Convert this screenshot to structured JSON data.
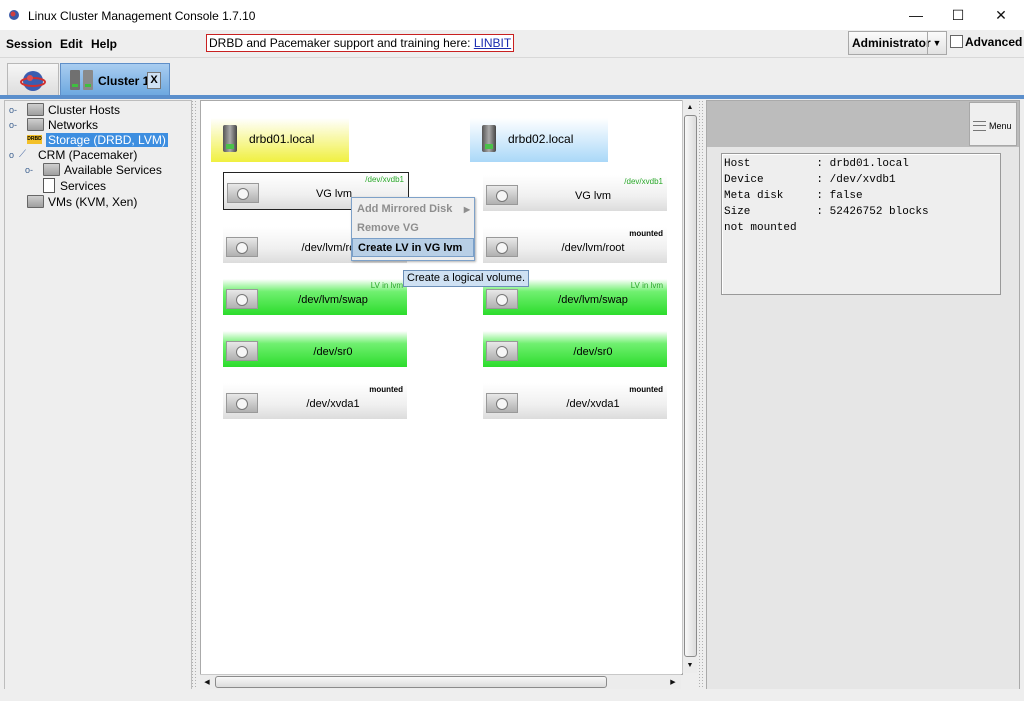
{
  "window": {
    "title": "Linux Cluster Management Console 1.7.10",
    "minimize": "—",
    "maximize": "☐",
    "close": "✕"
  },
  "menubar": {
    "session": "Session",
    "edit": "Edit",
    "help": "Help",
    "banner_text": "DRBD and Pacemaker support and training here: ",
    "banner_link": "LINBIT",
    "user": "Administrator",
    "advanced": "Advanced"
  },
  "tabs": {
    "cluster_label": "Cluster 1",
    "close": "X"
  },
  "tree": {
    "cluster_hosts": "Cluster Hosts",
    "networks": "Networks",
    "storage": "Storage (DRBD, LVM)",
    "crm": "CRM (Pacemaker)",
    "available_services": "Available Services",
    "services": "Services",
    "vms": "VMs (KVM, Xen)"
  },
  "hosts": [
    {
      "name": "drbd01.local"
    },
    {
      "name": "drbd02.local"
    }
  ],
  "blocks_left": [
    {
      "name": "VG lvm",
      "note": "/dev/xvdb1"
    },
    {
      "name": "/dev/lvm/root",
      "note": ""
    },
    {
      "name": "/dev/lvm/swap",
      "note": "LV in lvm"
    },
    {
      "name": "/dev/sr0",
      "note": ""
    },
    {
      "name": "/dev/xvda1",
      "note": "mounted"
    }
  ],
  "blocks_right": [
    {
      "name": "VG lvm",
      "note": "/dev/xvdb1"
    },
    {
      "name": "/dev/lvm/root",
      "note": "mounted"
    },
    {
      "name": "/dev/lvm/swap",
      "note": "LV in lvm"
    },
    {
      "name": "/dev/sr0",
      "note": ""
    },
    {
      "name": "/dev/xvda1",
      "note": "mounted"
    }
  ],
  "context_menu": {
    "add_mirrored_disk": "Add Mirrored Disk",
    "remove_vg": "Remove VG",
    "create_lv": "Create LV in VG lvm"
  },
  "tooltip": "Create a logical volume.",
  "info_panel": {
    "menu_label": "Menu",
    "rows": [
      "Host          : drbd01.local",
      "Device        : /dev/xvdb1",
      "Meta disk     : false",
      "Size          : 52426752 blocks",
      "not mounted"
    ]
  },
  "colors": {
    "host1": "#f0f040",
    "host2": "#aad8f8",
    "accent": "#5b8fcc",
    "green": "#2cdc2c"
  }
}
